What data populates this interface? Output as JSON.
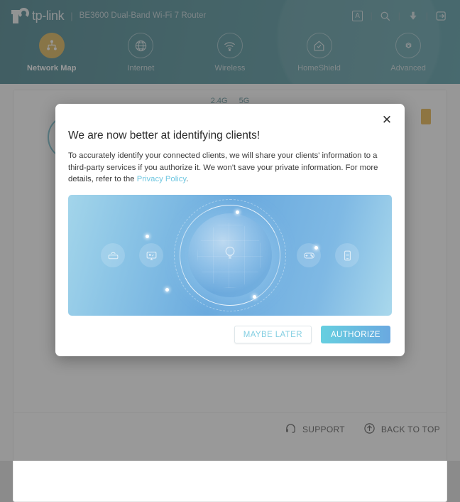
{
  "header": {
    "brand": "tp-link",
    "separator": "|",
    "model": "BE3600 Dual-Band Wi-Fi 7 Router",
    "icons": [
      {
        "name": "language-icon",
        "glyph": "A"
      },
      {
        "name": "search-icon",
        "glyph": "search"
      },
      {
        "name": "download-icon",
        "glyph": "download"
      },
      {
        "name": "logout-icon",
        "glyph": "logout"
      }
    ],
    "nav": [
      {
        "label": "Network Map",
        "icon": "network-map-icon",
        "active": true
      },
      {
        "label": "Internet",
        "icon": "globe-icon",
        "active": false
      },
      {
        "label": "Wireless",
        "icon": "wifi-icon",
        "active": false
      },
      {
        "label": "HomeShield",
        "icon": "home-shield-icon",
        "active": false
      },
      {
        "label": "Advanced",
        "icon": "gear-icon",
        "active": false
      }
    ],
    "accent_active": "#d3a029",
    "bar_color": "#23747f"
  },
  "page": {
    "band_tabs": [
      {
        "label": "2.4G"
      },
      {
        "label": "5G"
      }
    ],
    "footer": {
      "support_label": "SUPPORT",
      "back_to_top_label": "BACK TO TOP"
    }
  },
  "dialog": {
    "close_label": "✕",
    "title": "We are now better at identifying clients!",
    "body_part1": "To accurately identify your connected clients, we will share your clients' information to a third-party services if you authorize it. We won't save your private information. For more details, refer to the ",
    "link_text": "Privacy Policy",
    "body_part2": ".",
    "illustration": {
      "devices": [
        {
          "name": "router-icon"
        },
        {
          "name": "monitor-icon"
        },
        {
          "name": "game-controller-icon"
        },
        {
          "name": "phone-icon"
        }
      ],
      "center": "glowing-sphere-with-bulb",
      "gradient_from": "#a3d5ea",
      "gradient_to": "#6aaade"
    },
    "buttons": {
      "maybe_later": "MAYBE LATER",
      "authorize": "AUTHORIZE",
      "authorize_color": "#66cfe0"
    }
  }
}
